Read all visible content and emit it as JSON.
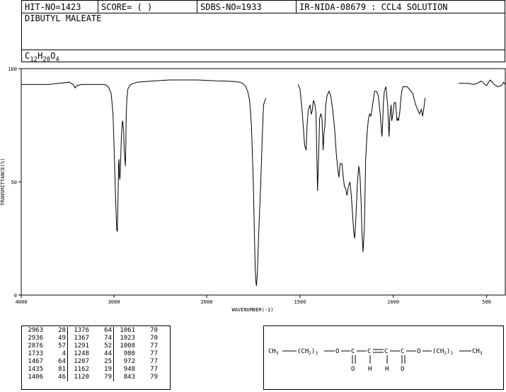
{
  "header": {
    "hit_no": "HIT-NO=1423",
    "score": "SCORE=  (   )",
    "sdbs_no": "SDBS-NO=1933",
    "ir_id": "IR-NIDA-08679 : CCL4 SOLUTION"
  },
  "compound": {
    "name": "DIBUTYL MALEATE",
    "formula_parts": [
      "C",
      "12",
      "H",
      "20",
      "O",
      "4"
    ]
  },
  "chart_data": {
    "type": "line",
    "xlabel": "WAVENUMBER(-1)",
    "ylabel": "TRANSMITTANCE(%)",
    "xlim": [
      4000,
      400
    ],
    "ylim": [
      0,
      100
    ],
    "x_ticks": [
      "4000",
      "3000",
      "2000",
      "1500",
      "1000",
      "500"
    ],
    "y_ticks": [
      "100",
      "50",
      "0"
    ],
    "segments": [
      [
        [
          4000,
          93
        ],
        [
          3900,
          93
        ],
        [
          3700,
          93
        ],
        [
          3600,
          93.5
        ],
        [
          3480,
          94
        ],
        [
          3440,
          93
        ],
        [
          3420,
          91.5
        ],
        [
          3400,
          92.5
        ],
        [
          3350,
          93
        ],
        [
          3200,
          93
        ],
        [
          3100,
          93
        ],
        [
          3060,
          92
        ],
        [
          3030,
          89
        ],
        [
          3010,
          80
        ],
        [
          2995,
          60
        ],
        [
          2980,
          40
        ],
        [
          2970,
          29
        ],
        [
          2963,
          28
        ],
        [
          2955,
          45
        ],
        [
          2950,
          58
        ],
        [
          2945,
          60
        ],
        [
          2940,
          52
        ],
        [
          2936,
          51
        ],
        [
          2930,
          56
        ],
        [
          2920,
          70
        ],
        [
          2910,
          76
        ],
        [
          2905,
          77
        ],
        [
          2895,
          72
        ],
        [
          2890,
          65
        ],
        [
          2885,
          61
        ],
        [
          2882,
          60
        ],
        [
          2876,
          57
        ],
        [
          2872,
          66
        ],
        [
          2868,
          79
        ],
        [
          2860,
          87
        ],
        [
          2850,
          91
        ],
        [
          2820,
          93
        ],
        [
          2750,
          94
        ],
        [
          2600,
          94.5
        ],
        [
          2400,
          95
        ],
        [
          2300,
          95
        ],
        [
          2200,
          95
        ],
        [
          2100,
          95
        ],
        [
          2000,
          94.8
        ],
        [
          1950,
          94.6
        ],
        [
          1900,
          94.5
        ],
        [
          1850,
          94.3
        ],
        [
          1820,
          94
        ],
        [
          1800,
          93
        ],
        [
          1790,
          92
        ],
        [
          1780,
          90
        ],
        [
          1770,
          86
        ],
        [
          1760,
          75
        ],
        [
          1750,
          50
        ],
        [
          1745,
          30
        ],
        [
          1740,
          12
        ],
        [
          1736,
          6
        ],
        [
          1733,
          4
        ],
        [
          1728,
          10
        ],
        [
          1722,
          25
        ],
        [
          1715,
          40
        ],
        [
          1710,
          50
        ],
        [
          1702,
          70
        ],
        [
          1695,
          84
        ],
        [
          1687,
          86
        ],
        [
          1683,
          87
        ]
      ],
      [
        [
          1510,
          93
        ],
        [
          1500,
          91
        ],
        [
          1490,
          83
        ],
        [
          1480,
          72
        ],
        [
          1475,
          66
        ],
        [
          1467,
          64
        ],
        [
          1462,
          75
        ],
        [
          1455,
          82
        ],
        [
          1446,
          84
        ],
        [
          1440,
          80
        ],
        [
          1435,
          81
        ],
        [
          1428,
          86
        ],
        [
          1420,
          84
        ],
        [
          1414,
          80
        ],
        [
          1406,
          46
        ],
        [
          1400,
          62
        ],
        [
          1395,
          78
        ],
        [
          1388,
          80
        ],
        [
          1382,
          78
        ],
        [
          1376,
          64
        ],
        [
          1371,
          72
        ],
        [
          1367,
          74
        ],
        [
          1362,
          84
        ],
        [
          1355,
          88
        ],
        [
          1345,
          90
        ],
        [
          1335,
          88
        ],
        [
          1325,
          82
        ],
        [
          1315,
          74
        ],
        [
          1305,
          62
        ],
        [
          1295,
          54
        ],
        [
          1291,
          52
        ],
        [
          1285,
          58
        ],
        [
          1275,
          58
        ],
        [
          1268,
          52
        ],
        [
          1262,
          48
        ],
        [
          1255,
          47
        ],
        [
          1248,
          44
        ],
        [
          1240,
          48
        ],
        [
          1232,
          50
        ],
        [
          1225,
          44
        ],
        [
          1218,
          35
        ],
        [
          1212,
          28
        ],
        [
          1207,
          25
        ],
        [
          1200,
          35
        ],
        [
          1192,
          50
        ],
        [
          1185,
          57
        ],
        [
          1178,
          52
        ],
        [
          1172,
          40
        ],
        [
          1168,
          28
        ],
        [
          1162,
          19
        ],
        [
          1155,
          30
        ],
        [
          1148,
          60
        ],
        [
          1140,
          72
        ],
        [
          1133,
          78
        ],
        [
          1127,
          80
        ],
        [
          1120,
          79
        ],
        [
          1114,
          82
        ],
        [
          1108,
          86
        ],
        [
          1100,
          90
        ],
        [
          1090,
          90
        ],
        [
          1080,
          88
        ],
        [
          1070,
          80
        ],
        [
          1061,
          70
        ],
        [
          1057,
          76
        ],
        [
          1053,
          85
        ],
        [
          1048,
          90
        ],
        [
          1040,
          92
        ],
        [
          1030,
          84
        ],
        [
          1023,
          70
        ],
        [
          1018,
          79
        ],
        [
          1012,
          84
        ],
        [
          1008,
          77
        ],
        [
          1002,
          80
        ],
        [
          995,
          85
        ],
        [
          988,
          85
        ],
        [
          980,
          77
        ],
        [
          975,
          78
        ],
        [
          972,
          77
        ],
        [
          966,
          80
        ],
        [
          960,
          86
        ],
        [
          955,
          90
        ],
        [
          948,
          92
        ],
        [
          940,
          92
        ],
        [
          925,
          92
        ],
        [
          915,
          91
        ],
        [
          905,
          90
        ],
        [
          895,
          89
        ],
        [
          890,
          87
        ],
        [
          880,
          84
        ],
        [
          870,
          82
        ],
        [
          860,
          80
        ],
        [
          850,
          82
        ],
        [
          843,
          79
        ],
        [
          837,
          82
        ],
        [
          830,
          87
        ]
      ],
      [
        [
          650,
          93.5
        ],
        [
          600,
          93.5
        ],
        [
          570,
          93
        ],
        [
          550,
          93.5
        ],
        [
          540,
          94
        ],
        [
          530,
          94.5
        ],
        [
          520,
          94
        ],
        [
          510,
          93
        ],
        [
          500,
          92.5
        ],
        [
          490,
          94
        ],
        [
          480,
          95
        ],
        [
          470,
          94
        ],
        [
          460,
          93
        ],
        [
          440,
          92
        ],
        [
          420,
          92.5
        ],
        [
          410,
          94
        ],
        [
          400,
          93
        ]
      ]
    ]
  },
  "peak_table": {
    "columns": [
      [
        [
          "2963",
          "28"
        ],
        [
          "2936",
          "49"
        ],
        [
          "2876",
          "57"
        ],
        [
          "1733",
          "4"
        ],
        [
          "1467",
          "64"
        ],
        [
          "1435",
          "81"
        ],
        [
          "1406",
          "46"
        ]
      ],
      [
        [
          "1376",
          "64"
        ],
        [
          "1367",
          "74"
        ],
        [
          "1291",
          "52"
        ],
        [
          "1248",
          "44"
        ],
        [
          "1207",
          "25"
        ],
        [
          "1162",
          "19"
        ],
        [
          "1120",
          "79"
        ]
      ],
      [
        [
          "1061",
          "70"
        ],
        [
          "1023",
          "70"
        ],
        [
          "1008",
          "77"
        ],
        [
          "980",
          "77"
        ],
        [
          "972",
          "77"
        ],
        [
          "948",
          "77"
        ],
        [
          "843",
          "79"
        ]
      ]
    ]
  },
  "structure": {
    "ch3_left": "CH3",
    "ch2_left": "(CH2)3",
    "o_left": "O",
    "c1": "C",
    "c2": "C",
    "c3": "C",
    "c4": "C",
    "o_right": "O",
    "ch2_right": "(CH2)3",
    "ch3_right": "CH3",
    "o_down_left": "O",
    "h_left": "H",
    "h_right": "H",
    "o_down_right": "O"
  }
}
